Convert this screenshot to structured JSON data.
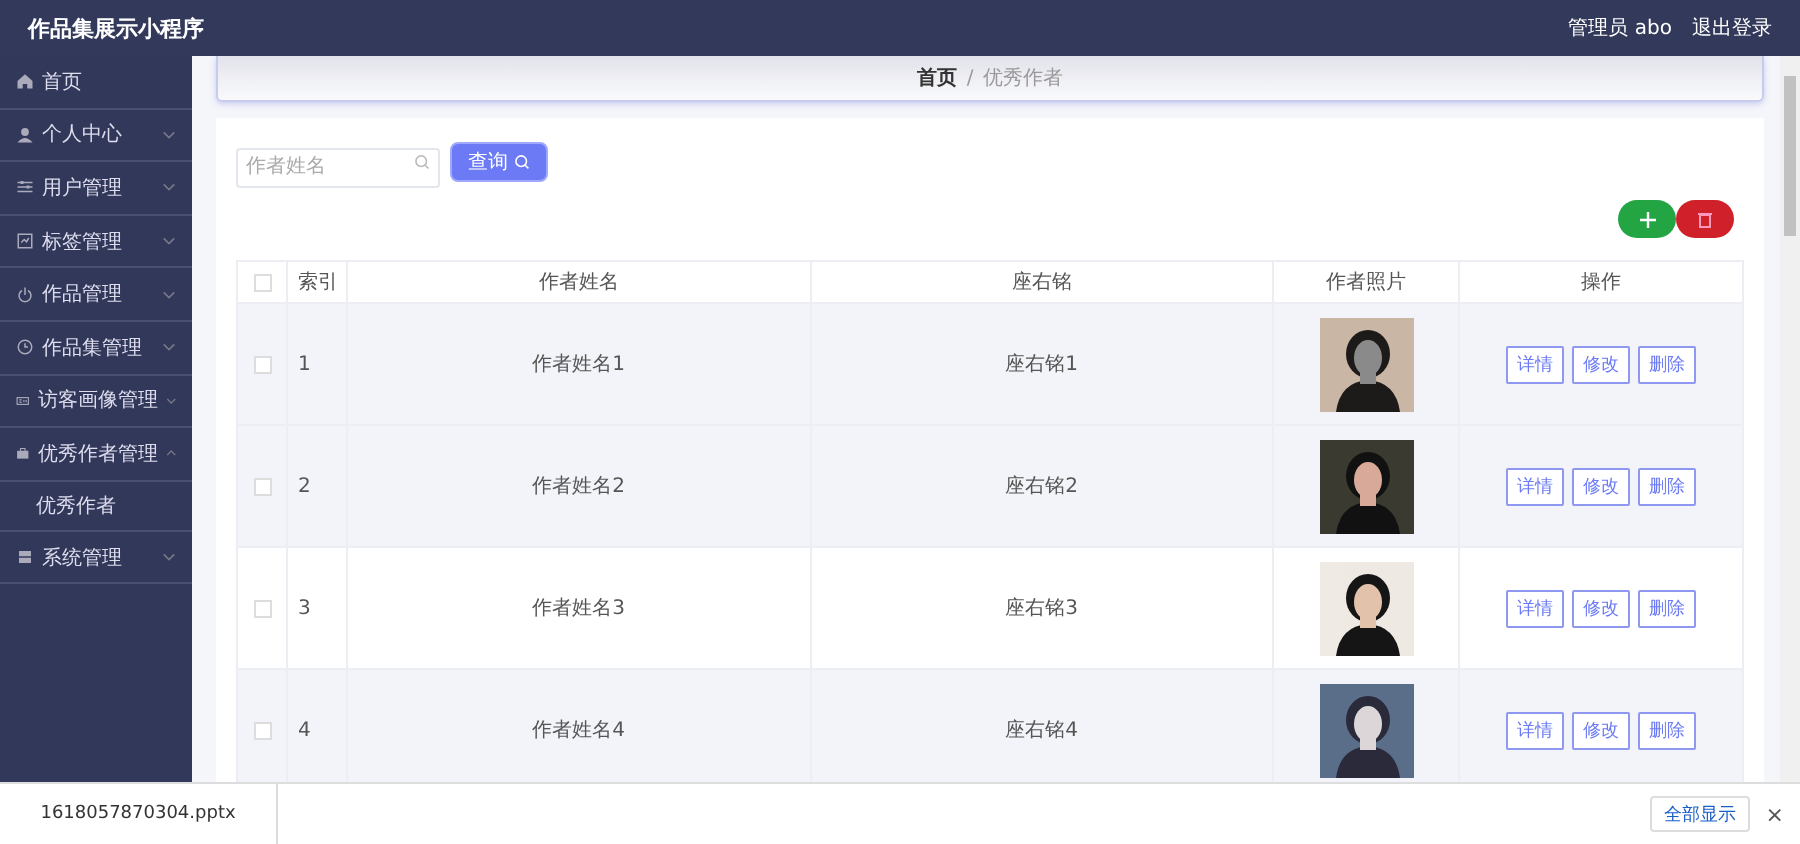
{
  "header": {
    "title": "作品集展示小程序",
    "user": "管理员 abo",
    "logout": "退出登录"
  },
  "sidebar": {
    "items": [
      {
        "label": "首页",
        "kind": "link"
      },
      {
        "label": "个人中心",
        "kind": "menu",
        "expanded": false
      },
      {
        "label": "用户管理",
        "kind": "menu",
        "expanded": false
      },
      {
        "label": "标签管理",
        "kind": "menu",
        "expanded": false
      },
      {
        "label": "作品管理",
        "kind": "menu",
        "expanded": false
      },
      {
        "label": "作品集管理",
        "kind": "menu",
        "expanded": false
      },
      {
        "label": "访客画像管理",
        "kind": "menu",
        "expanded": false
      },
      {
        "label": "优秀作者管理",
        "kind": "menu",
        "expanded": true,
        "children": [
          {
            "label": "优秀作者"
          }
        ]
      },
      {
        "label": "系统管理",
        "kind": "menu",
        "expanded": false
      }
    ]
  },
  "breadcrumb": {
    "items": [
      "首页",
      "优秀作者"
    ],
    "separator": "/"
  },
  "search": {
    "placeholder": "作者姓名",
    "button": "查询"
  },
  "table": {
    "all_checked": false,
    "columns": [
      "索引",
      "作者姓名",
      "座右铭",
      "作者照片",
      "操作"
    ],
    "rows": [
      {
        "checked": false,
        "highlighted": true,
        "index": "1",
        "name": "作者姓名1",
        "motto": "座右铭1",
        "photo": {
          "kind": "picture"
        },
        "actions": [
          "详情",
          "修改",
          "删除"
        ]
      },
      {
        "checked": false,
        "highlighted": true,
        "index": "2",
        "name": "作者姓名2",
        "motto": "座右铭2",
        "photo": {
          "kind": "picture"
        },
        "actions": [
          "详情",
          "修改",
          "删除"
        ]
      },
      {
        "checked": false,
        "highlighted": false,
        "index": "3",
        "name": "作者姓名3",
        "motto": "座右铭3",
        "photo": {
          "kind": "picture"
        },
        "actions": [
          "详情",
          "修改",
          "删除"
        ]
      },
      {
        "checked": false,
        "highlighted": true,
        "index": "4",
        "name": "作者姓名4",
        "motto": "座右铭4",
        "photo": {
          "kind": "picture"
        },
        "actions": [
          "详情",
          "修改",
          "删除"
        ]
      }
    ]
  },
  "download_bar": {
    "file": "1618057870304.pptx",
    "show_all": "全部显示",
    "close": "×"
  }
}
